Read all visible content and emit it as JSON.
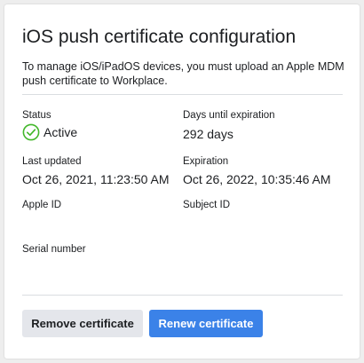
{
  "header": {
    "title": "iOS push certificate configuration",
    "description": "To manage iOS/iPadOS devices, you must upload an Apple MDM push certificate to Workplace."
  },
  "fields": {
    "status": {
      "label": "Status",
      "value": "Active",
      "icon": "check-circle-icon",
      "color": "#42b72a"
    },
    "days_until_expiration": {
      "label": "Days until expiration",
      "value": "292 days"
    },
    "last_updated": {
      "label": "Last updated",
      "value": "Oct 26, 2021, 11:23:50 AM"
    },
    "expiration": {
      "label": "Expiration",
      "value": "Oct 26, 2022, 10:35:46 AM"
    },
    "apple_id": {
      "label": "Apple ID",
      "value": ""
    },
    "subject_id": {
      "label": "Subject ID",
      "value": ""
    },
    "serial_number": {
      "label": "Serial number",
      "value": ""
    }
  },
  "actions": {
    "remove_label": "Remove certificate",
    "renew_label": "Renew certificate"
  },
  "colors": {
    "primary": "#3b82e8",
    "secondary_bg": "#e4e6eb",
    "success": "#42b72a"
  }
}
